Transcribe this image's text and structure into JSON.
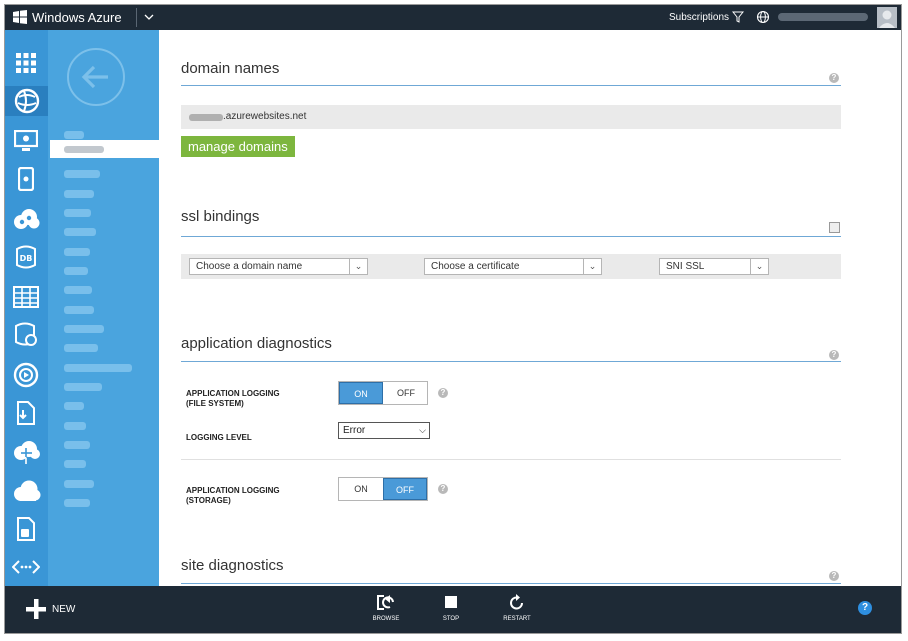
{
  "app": {
    "brand": "Windows Azure",
    "subscriptions_label": "Subscriptions"
  },
  "sections": {
    "domain_names": {
      "title": "domain names",
      "domain_suffix": ".azurewebsites.net",
      "manage_label": "manage domains"
    },
    "ssl_bindings": {
      "title": "ssl bindings",
      "domain_select": "Choose a domain name",
      "cert_select": "Choose a certificate",
      "ssl_type_select": "SNI SSL"
    },
    "app_diagnostics": {
      "title": "application diagnostics",
      "fs_logging_label_1": "APPLICATION LOGGING",
      "fs_logging_label_2": "(FILE SYSTEM)",
      "fs_on": "ON",
      "fs_off": "OFF",
      "fs_state": "ON",
      "level_label": "LOGGING LEVEL",
      "level_value": "Error",
      "storage_logging_label_1": "APPLICATION LOGGING",
      "storage_logging_label_2": "(STORAGE)",
      "st_on": "ON",
      "st_off": "OFF",
      "st_state": "OFF"
    },
    "site_diagnostics": {
      "title": "site diagnostics"
    }
  },
  "bottombar": {
    "new_label": "NEW",
    "browse_label": "BROWSE",
    "stop_label": "STOP",
    "restart_label": "RESTART",
    "help_glyph": "?"
  },
  "help_glyph": "?",
  "colors": {
    "accent": "#4a9ad8",
    "rail": "#3a96d6",
    "nav": "#4aa4de",
    "topbar": "#1e2a36",
    "green": "#7db63e"
  }
}
